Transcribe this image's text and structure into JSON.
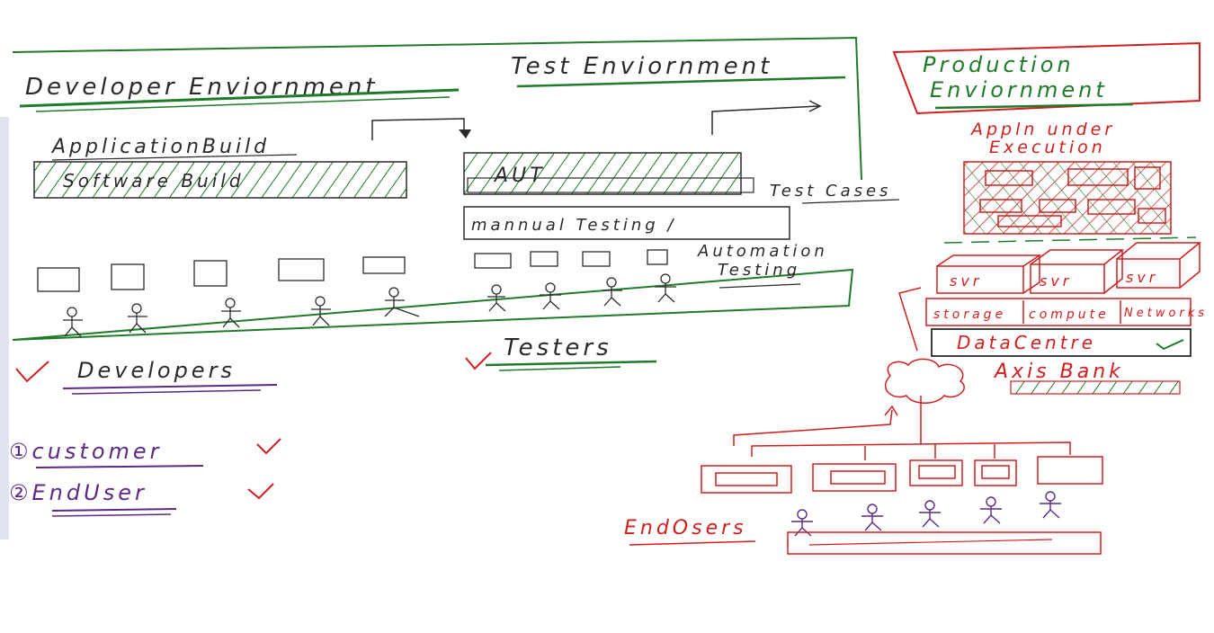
{
  "colors": {
    "green": "#1f7a2a",
    "black": "#2a2a2a",
    "red": "#d21d1d",
    "purple": "#5b2a86",
    "left_strip": "#dfe4ee"
  },
  "developer_env": {
    "title": "Developer Enviornment",
    "app_build": "ApplicationBuild",
    "software_build": "Software Build"
  },
  "test_env": {
    "title": "Test Enviornment",
    "aut": "AUT",
    "test_cases": "Test Cases",
    "manual_testing": "mannual Testing /",
    "automation_testing_1": "Automation",
    "automation_testing_2": "Testing"
  },
  "roles": {
    "developers": "Developers",
    "testers": "Testers"
  },
  "list": {
    "item1": "①customer",
    "item2": "②EndUser"
  },
  "production": {
    "title_1": "Production",
    "title_2": "Enviornment",
    "appln_1": "Appln under",
    "appln_2": "Execution",
    "svr1": "svr",
    "svr2": "svr",
    "svr3": "svr",
    "storage": "storage",
    "compute": "compute",
    "network": "Networks",
    "datacentre": "DataCentre",
    "bank": "Axis Bank",
    "endusers": "EndOsers"
  }
}
